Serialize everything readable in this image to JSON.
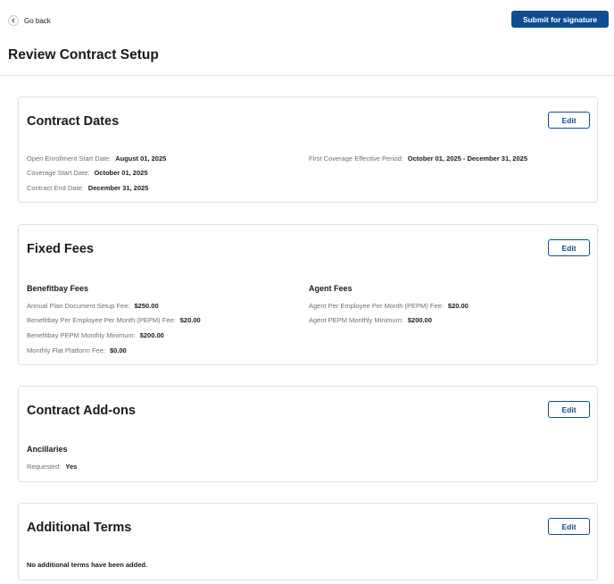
{
  "header": {
    "back_label": "Go back",
    "submit_label": "Submit for signature"
  },
  "page_title": "Review Contract Setup",
  "contract_dates": {
    "title": "Contract Dates",
    "edit_label": "Edit",
    "fields": [
      {
        "label": "Open Enrollment Start Date:",
        "value": "August 01, 2025"
      },
      {
        "label": "Coverage Start Date:",
        "value": "October 01, 2025"
      },
      {
        "label": "Contract End Date:",
        "value": "December 31, 2025"
      },
      {
        "label": "First Coverage Effective Period:",
        "value": "October 01, 2025 - December 31, 2025"
      }
    ]
  },
  "fixed_fees": {
    "title": "Fixed Fees",
    "edit_label": "Edit",
    "benefitbay": {
      "heading": "Benefitbay Fees",
      "fields": [
        {
          "label": "Annual Plan Document Setup Fee:",
          "value": "$250.00"
        },
        {
          "label": "Benefitbay Per Employee Per Month (PEPM) Fee:",
          "value": "$20.00"
        },
        {
          "label": "Benefitbay PEPM Monthly Minimum:",
          "value": "$200.00"
        },
        {
          "label": "Monthly Flat Platform Fee:",
          "value": "$0.00"
        }
      ]
    },
    "agent": {
      "heading": "Agent Fees",
      "fields": [
        {
          "label": "Agent Per Employee Per Month (PEPM) Fee:",
          "value": "$20.00"
        },
        {
          "label": "Agent PEPM Monthly Minimum:",
          "value": "$200.00"
        }
      ]
    }
  },
  "contract_addons": {
    "title": "Contract Add-ons",
    "edit_label": "Edit",
    "heading": "Ancillaries",
    "fields": [
      {
        "label": "Requested:",
        "value": "Yes"
      }
    ]
  },
  "additional_terms": {
    "title": "Additional Terms",
    "edit_label": "Edit",
    "note": "No additional terms have been added."
  }
}
